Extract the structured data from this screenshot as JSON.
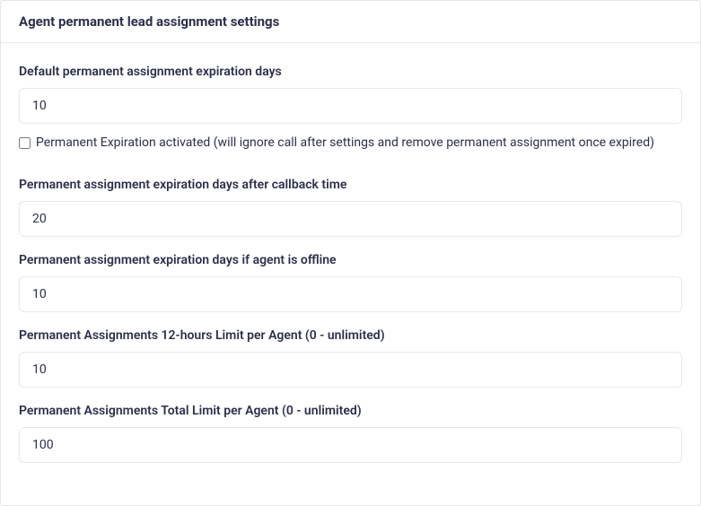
{
  "header": {
    "title": "Agent permanent lead assignment settings"
  },
  "form": {
    "default_expiration": {
      "label": "Default permanent assignment expiration days",
      "value": "10"
    },
    "expiration_activated": {
      "label": "Permanent Expiration activated (will ignore call after settings and remove permanent assignment once expired)"
    },
    "expiration_after_callback": {
      "label": "Permanent assignment expiration days after callback time",
      "value": "20"
    },
    "expiration_if_offline": {
      "label": "Permanent assignment expiration days if agent is offline",
      "value": "10"
    },
    "limit_12hours": {
      "label": "Permanent Assignments 12-hours Limit per Agent (0 - unlimited)",
      "value": "10"
    },
    "limit_total": {
      "label": "Permanent Assignments Total Limit per Agent (0 - unlimited)",
      "value": "100"
    }
  }
}
